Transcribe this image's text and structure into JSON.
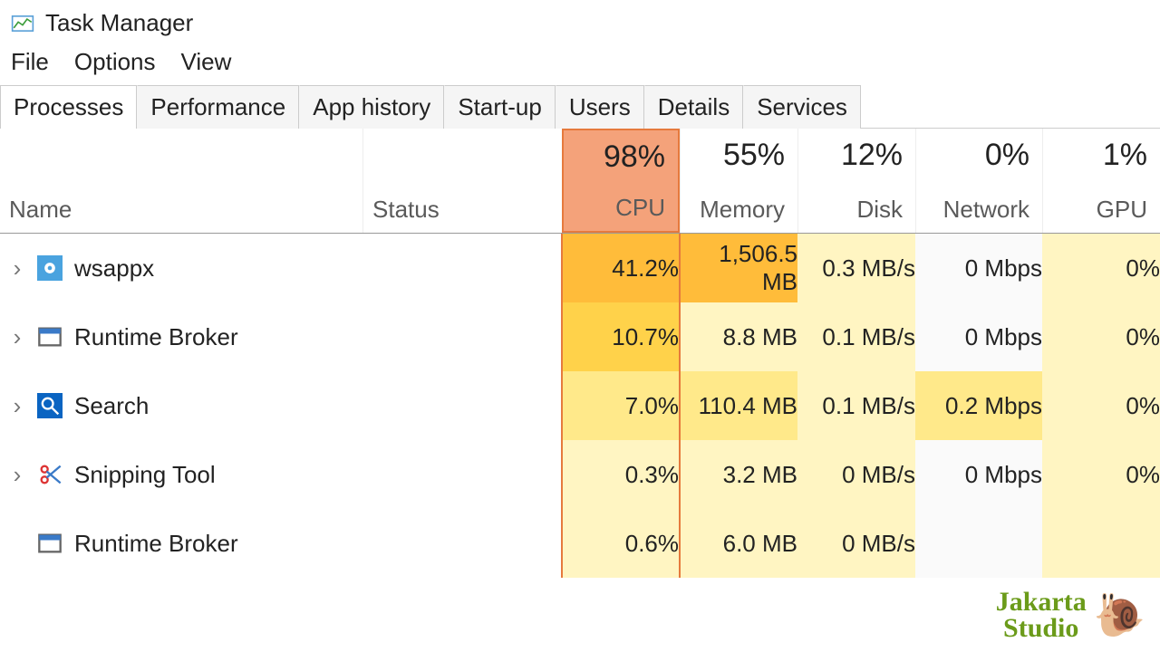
{
  "window": {
    "title": "Task Manager"
  },
  "menu": {
    "file": "File",
    "options": "Options",
    "view": "View"
  },
  "tabs": {
    "processes": "Processes",
    "performance": "Performance",
    "app_history": "App history",
    "startup": "Start-up",
    "users": "Users",
    "details": "Details",
    "services": "Services"
  },
  "columns": {
    "name": "Name",
    "status": "Status",
    "cpu": {
      "pct": "98%",
      "label": "CPU"
    },
    "memory": {
      "pct": "55%",
      "label": "Memory"
    },
    "disk": {
      "pct": "12%",
      "label": "Disk"
    },
    "network": {
      "pct": "0%",
      "label": "Network"
    },
    "gpu": {
      "pct": "1%",
      "label": "GPU"
    }
  },
  "rows": [
    {
      "name": "wsappx",
      "cpu": "41.2%",
      "memory": "1,506.5 MB",
      "disk": "0.3 MB/s",
      "network": "0 Mbps",
      "gpu": "0%"
    },
    {
      "name": "Runtime Broker",
      "cpu": "10.7%",
      "memory": "8.8 MB",
      "disk": "0.1 MB/s",
      "network": "0 Mbps",
      "gpu": "0%"
    },
    {
      "name": "Search",
      "cpu": "7.0%",
      "memory": "110.4 MB",
      "disk": "0.1 MB/s",
      "network": "0.2 Mbps",
      "gpu": "0%"
    },
    {
      "name": "Snipping Tool",
      "cpu": "0.3%",
      "memory": "3.2 MB",
      "disk": "0 MB/s",
      "network": "0 Mbps",
      "gpu": "0%"
    },
    {
      "name": "Runtime Broker",
      "cpu": "0.6%",
      "memory": "6.0 MB",
      "disk": "0 MB/s",
      "network": "",
      "gpu": ""
    }
  ],
  "watermark": {
    "line1": "Jakarta",
    "line2": "Studio"
  }
}
